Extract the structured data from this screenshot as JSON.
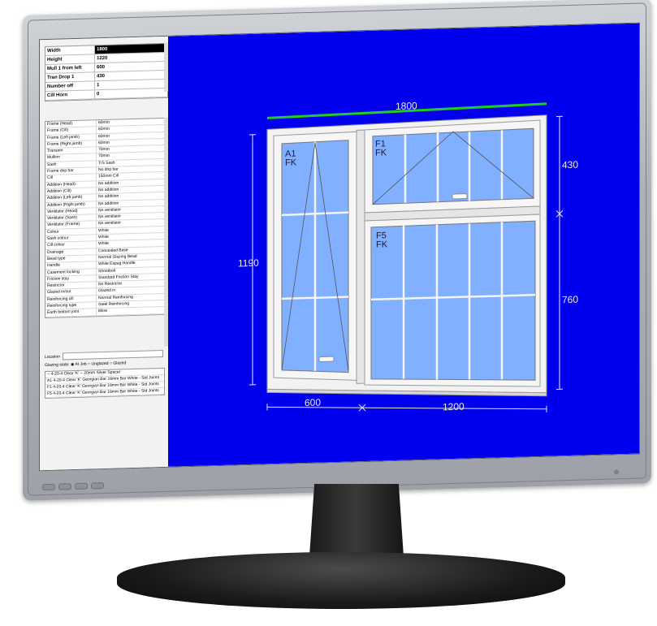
{
  "top_fields": [
    {
      "label": "Width",
      "value": "1800"
    },
    {
      "label": "Height",
      "value": "1220"
    },
    {
      "label": "Mull 1 from left",
      "value": "600"
    },
    {
      "label": "Tran Drop 1",
      "value": "430"
    },
    {
      "label": "Number off",
      "value": "1"
    },
    {
      "label": "Cill Horn",
      "value": "0"
    }
  ],
  "properties": [
    {
      "label": "Frame (Head)",
      "value": "60mm"
    },
    {
      "label": "Frame (Cill)",
      "value": "60mm"
    },
    {
      "label": "Frame (Left jamb)",
      "value": "60mm"
    },
    {
      "label": "Frame (Right jamb)",
      "value": "60mm"
    },
    {
      "label": "Transom",
      "value": "70mm"
    },
    {
      "label": "Mullion",
      "value": "70mm"
    },
    {
      "label": "Sash",
      "value": "T/S Sash"
    },
    {
      "label": "Frame drip bar",
      "value": "No drip bar"
    },
    {
      "label": "Cill",
      "value": "150mm Cill"
    },
    {
      "label": "Addition (Head)",
      "value": "No addition"
    },
    {
      "label": "Addition (Cill)",
      "value": "No addition"
    },
    {
      "label": "Addition (Left jamb)",
      "value": "No addition"
    },
    {
      "label": "Addition (Right jamb)",
      "value": "No addition"
    },
    {
      "label": "Ventilator (Head)",
      "value": "No ventilator"
    },
    {
      "label": "Ventilator (Sash)",
      "value": "No ventilator"
    },
    {
      "label": "Ventilator (Frame)",
      "value": "No ventilator"
    },
    {
      "label": "Colour",
      "value": "White"
    },
    {
      "label": "Sash colour",
      "value": "White"
    },
    {
      "label": "Cill colour",
      "value": "White"
    },
    {
      "label": "Drainage",
      "value": "Concealed Base"
    },
    {
      "label": "Bead type",
      "value": "Normal Glazing Bead"
    },
    {
      "label": "Handle",
      "value": "White Espag Handle"
    },
    {
      "label": "Casement locking",
      "value": "Shootbolt"
    },
    {
      "label": "Friction stay",
      "value": "Standard Friction Stay"
    },
    {
      "label": "Restrictor",
      "value": "No Restrictor"
    },
    {
      "label": "Glazed in/out",
      "value": "Glazed in"
    },
    {
      "label": "Reinforcing cill",
      "value": "Normal Reinforcing"
    },
    {
      "label": "Reinforcing type",
      "value": "Steel Reinforcing"
    },
    {
      "label": "Earth bottom joint",
      "value": "Mitre"
    }
  ],
  "location_label": "Location",
  "glazing_state": {
    "label": "Glazing state",
    "options": [
      "At Job",
      "Unglazed",
      "Glazed"
    ]
  },
  "glass_list": [
    "-- 4-20-4 Clear 'K' -- 20mm Silver Spacer",
    "A1 4-20-4 Clear 'K' Georgian Bar 18mm Bar White - Std Joints",
    "F1 4-20-4 Clear 'K' Georgian Bar 18mm Bar White - Std Joints",
    "F5 4-20-4 Clear 'K' Georgian Bar 18mm Bar White - Std Joints"
  ],
  "drawing": {
    "width_dim": "1800",
    "height_dim": "1190",
    "top_right_dim": "430",
    "bottom_right_dim": "760",
    "bottom_left_dim": "600",
    "bottom_right_width_dim": "1200",
    "sashes": [
      {
        "code": "A1",
        "type": "FK"
      },
      {
        "code": "F1",
        "type": "FK"
      },
      {
        "code": "F5",
        "type": "FK"
      }
    ],
    "colors": {
      "background": "#0000ee",
      "glass": "#80b0ff",
      "frame": "#f2f2f2",
      "width_line": "#22cc22"
    }
  }
}
